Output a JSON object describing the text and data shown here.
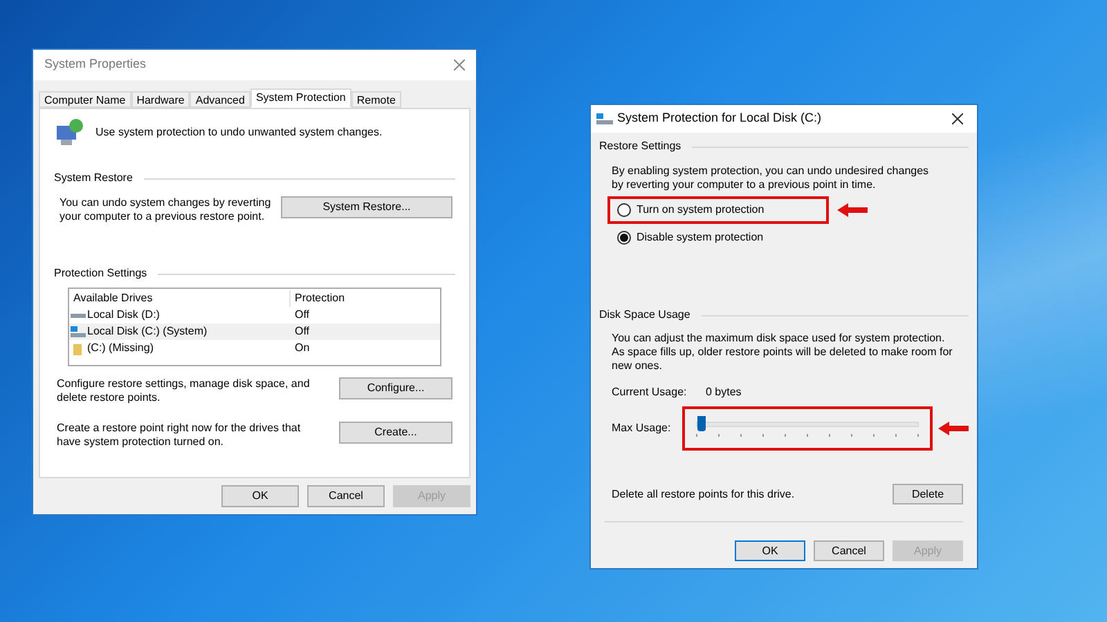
{
  "system_properties": {
    "title": "System Properties",
    "tabs": [
      {
        "label": "Computer Name",
        "selected": false
      },
      {
        "label": "Hardware",
        "selected": false
      },
      {
        "label": "Advanced",
        "selected": false
      },
      {
        "label": "System Protection",
        "selected": true
      },
      {
        "label": "Remote",
        "selected": false
      }
    ],
    "intro": "Use system protection to undo unwanted system changes.",
    "restore_heading": "System Restore",
    "restore_text": "You can undo system changes by reverting your computer to a previous restore point.",
    "restore_button": "System Restore...",
    "protection_heading": "Protection Settings",
    "drives_columns": [
      "Available Drives",
      "Protection"
    ],
    "drives": [
      {
        "kind": "disk",
        "name": "Local Disk (D:)",
        "protection": "Off",
        "selected": false
      },
      {
        "kind": "system",
        "name": "Local Disk (C:) (System)",
        "protection": "Off",
        "selected": true
      },
      {
        "kind": "folder",
        "name": "(C:) (Missing)",
        "protection": "On",
        "selected": false
      }
    ],
    "configure_text": "Configure restore settings, manage disk space, and delete restore points.",
    "configure_button": "Configure...",
    "create_text": "Create a restore point right now for the drives that have system protection turned on.",
    "create_button": "Create...",
    "buttons": [
      {
        "label": "OK",
        "disabled": false
      },
      {
        "label": "Cancel",
        "disabled": false
      },
      {
        "label": "Apply",
        "disabled": true
      }
    ]
  },
  "protection_dialog": {
    "title": "System Protection for Local Disk (C:)",
    "restore_heading": "Restore Settings",
    "restore_text": "By enabling system protection, you can undo undesired changes by reverting your computer to a previous point in time.",
    "options": [
      {
        "label": "Turn on system protection",
        "selected": false,
        "highlighted": true
      },
      {
        "label": "Disable system protection",
        "selected": true,
        "highlighted": false
      }
    ],
    "usage_heading": "Disk Space Usage",
    "usage_text": "You can adjust the maximum disk space used for system protection. As space fills up, older restore points will be deleted to make room for new ones.",
    "current_label": "Current Usage:",
    "current_value": "0 bytes",
    "max_label": "Max Usage:",
    "max_slider": {
      "level": 0.02,
      "highlighted": true
    },
    "delete_text": "Delete all restore points for this drive.",
    "delete_button": "Delete",
    "buttons": [
      {
        "label": "OK",
        "disabled": false,
        "default": true
      },
      {
        "label": "Cancel",
        "disabled": false,
        "default": false
      },
      {
        "label": "Apply",
        "disabled": true,
        "default": false
      }
    ]
  }
}
